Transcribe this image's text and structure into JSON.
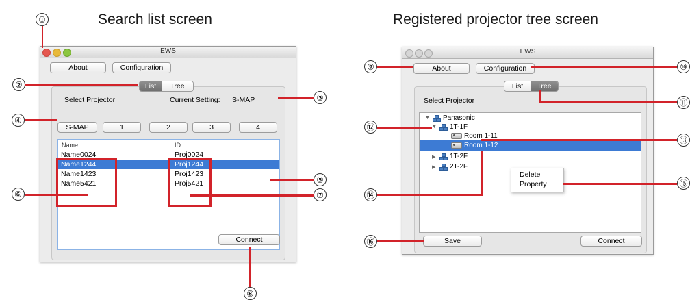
{
  "captions": {
    "left": "Search list screen",
    "right": "Registered projector tree screen"
  },
  "left_window": {
    "title": "EWS",
    "about_button": "About",
    "config_button": "Configuration",
    "tabs": [
      "List",
      "Tree"
    ],
    "active_tab": "List",
    "select_label": "Select Projector",
    "current_setting_label": "Current Setting:",
    "current_setting_value": "S-MAP",
    "map_buttons": [
      "S-MAP",
      "1",
      "2",
      "3",
      "4"
    ],
    "columns": [
      "Name",
      "ID"
    ],
    "rows": [
      {
        "name": "Name0024",
        "id": "Proj0024"
      },
      {
        "name": "Name1244",
        "id": "Proj1244"
      },
      {
        "name": "Name1423",
        "id": "Proj1423"
      },
      {
        "name": "Name5421",
        "id": "Proj5421"
      }
    ],
    "selected_row": 1,
    "connect_button": "Connect"
  },
  "right_window": {
    "title": "EWS",
    "about_button": "About",
    "config_button": "Configuration",
    "tabs": [
      "List",
      "Tree"
    ],
    "active_tab": "Tree",
    "select_label": "Select Projector",
    "tree": {
      "root": "Panasonic",
      "group1": "1T-1F",
      "room1": "Room 1-11",
      "room2": "Room 1-12",
      "group2": "1T-2F",
      "group3": "2T-2F"
    },
    "context_menu": [
      "Delete",
      "Property"
    ],
    "save_button": "Save",
    "connect_button": "Connect"
  },
  "callouts": {
    "n1": "①",
    "n2": "②",
    "n3": "③",
    "n4": "④",
    "n5": "⑤",
    "n6": "⑥",
    "n7": "⑦",
    "n8": "⑧",
    "n9": "⑨",
    "n10": "⑩",
    "n11": "⑪",
    "n12": "⑫",
    "n13": "⑬",
    "n14": "⑭",
    "n15": "⑮",
    "n16": "⑯"
  },
  "colors": {
    "annotation_red": "#d2232a",
    "selection_blue": "#3d7bd4",
    "active_tab_gray": "#7f7f7f"
  }
}
